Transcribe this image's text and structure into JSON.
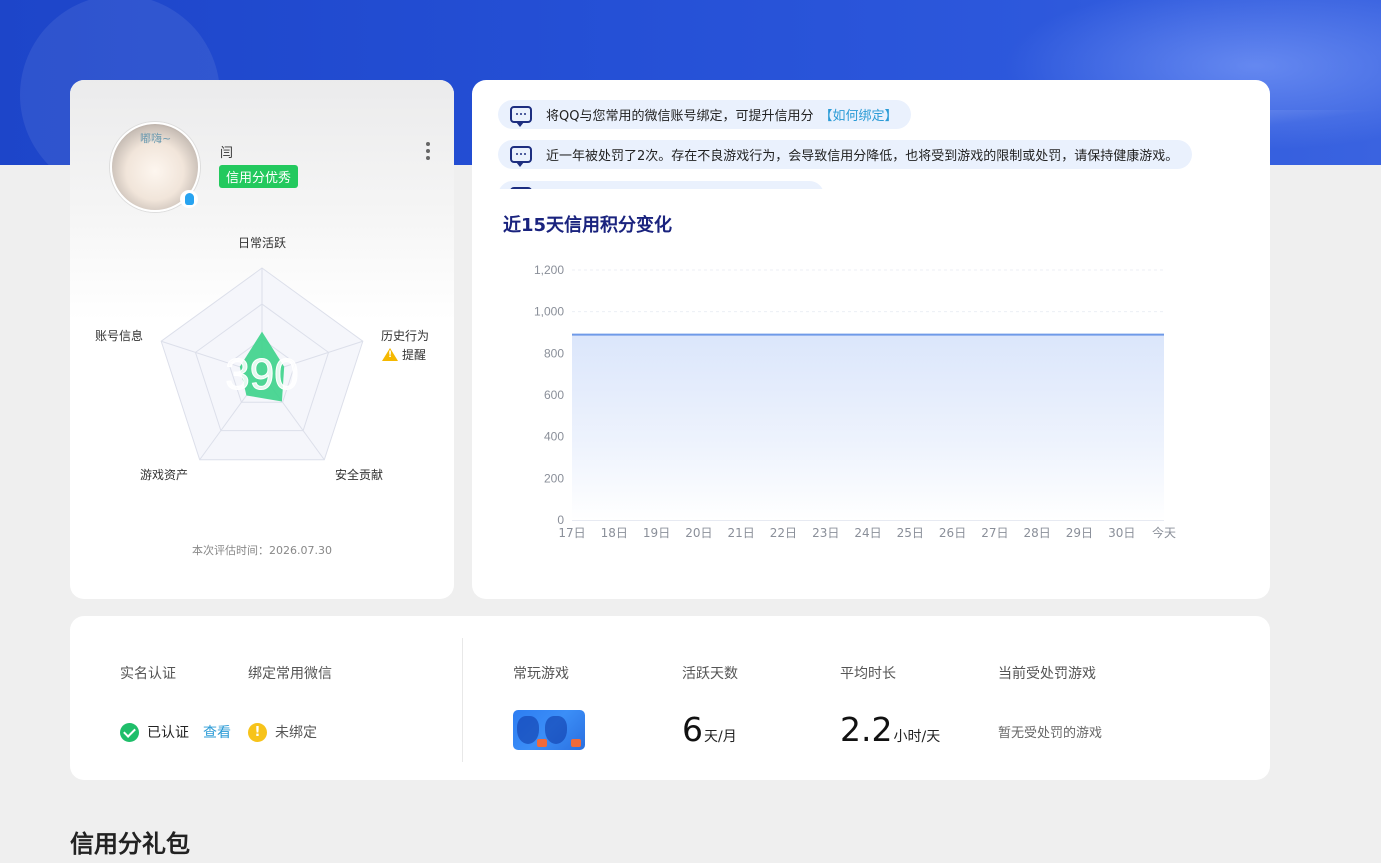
{
  "profile": {
    "avatar_tag": "嘟嗨~",
    "username": "闫",
    "credit_level": "信用分优秀",
    "score": "390",
    "radar_labels": {
      "daily_active": "日常活跃",
      "history": "历史行为",
      "security": "安全贡献",
      "assets": "游戏资产",
      "account": "账号信息"
    },
    "history_warning": "提醒",
    "eval_time": "本次评估时间：2026.07.30",
    "radar_values": {
      "daily_active": 0.4,
      "history": 0.22,
      "security": 0.32,
      "assets": 0.25,
      "account": 0.22
    }
  },
  "notices": [
    {
      "text": "将QQ与您常用的微信账号绑定，可提升信用分",
      "link": "【如何绑定】"
    },
    {
      "text": "近一年被处罚了2次。存在不良游戏行为，会导致信用分降低，也将受到游戏的限制或处罚，请保持健康游戏。"
    }
  ],
  "chart_title": "近15天信用积分变化",
  "chart_data": {
    "type": "area",
    "x": [
      "17日",
      "18日",
      "19日",
      "20日",
      "21日",
      "22日",
      "23日",
      "24日",
      "25日",
      "26日",
      "27日",
      "28日",
      "29日",
      "30日",
      "今天"
    ],
    "y": [
      890,
      890,
      890,
      890,
      890,
      890,
      890,
      890,
      890,
      890,
      890,
      890,
      890,
      890,
      890
    ],
    "yticks": [
      "0",
      "200",
      "400",
      "600",
      "800",
      "1,000",
      "1,200"
    ],
    "ylim": [
      0,
      1200
    ],
    "grid": true,
    "color": "#6f9ae8"
  },
  "stats": {
    "real_name_label": "实名认证",
    "wechat_label": "绑定常用微信",
    "verified_text": "已认证",
    "view_link": "查看",
    "unbound_text": "未绑定",
    "frequent_games_label": "常玩游戏",
    "active_days_label": "活跃天数",
    "active_days_value": "6",
    "active_days_unit": "天/月",
    "avg_time_label": "平均时长",
    "avg_time_value": "2.2",
    "avg_time_unit": "小时/天",
    "punished_label": "当前受处罚游戏",
    "punished_value": "暂无受处罚的游戏"
  },
  "section_title": "信用分礼包"
}
